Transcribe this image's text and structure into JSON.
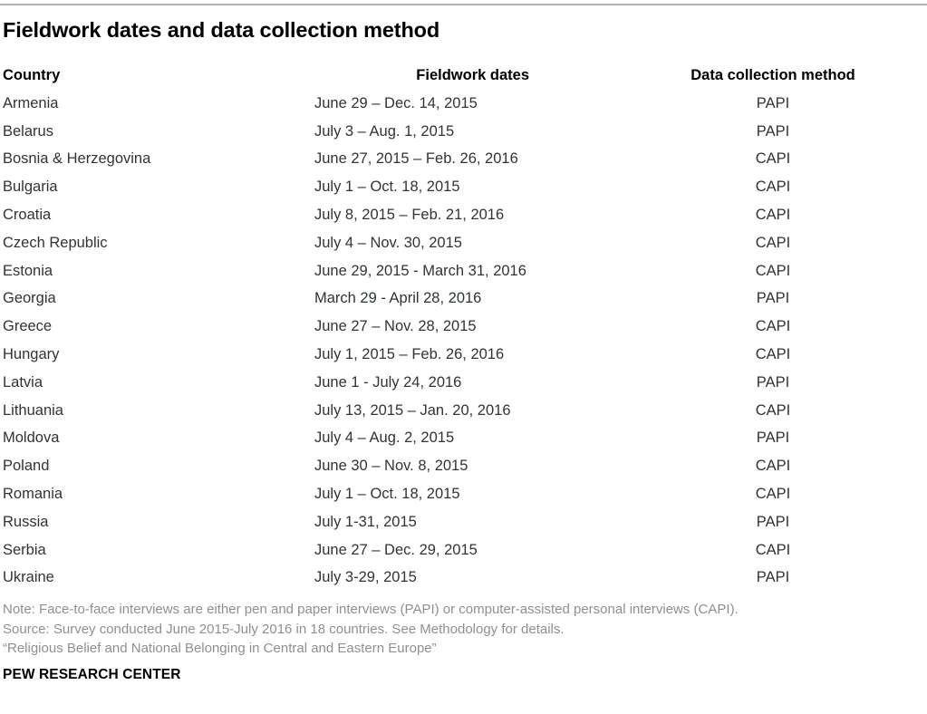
{
  "title": "Fieldwork dates and data collection method",
  "rule_color": "#b2b2b2",
  "table": {
    "headers": {
      "country": "Country",
      "dates": "Fieldwork dates",
      "method": "Data collection method"
    },
    "rows": [
      {
        "country": "Armenia",
        "dates": "June 29 – Dec. 14, 2015",
        "method": "PAPI"
      },
      {
        "country": "Belarus",
        "dates": "July 3 – Aug. 1, 2015",
        "method": "PAPI"
      },
      {
        "country": "Bosnia & Herzegovina",
        "dates": "June 27, 2015 – Feb. 26, 2016",
        "method": "CAPI"
      },
      {
        "country": "Bulgaria",
        "dates": "July 1 – Oct. 18, 2015",
        "method": "CAPI"
      },
      {
        "country": "Croatia",
        "dates": "July 8, 2015 – Feb. 21, 2016",
        "method": "CAPI"
      },
      {
        "country": "Czech Republic",
        "dates": "July 4 – Nov. 30, 2015",
        "method": "CAPI"
      },
      {
        "country": "Estonia",
        "dates": "June 29, 2015 - March 31, 2016",
        "method": "CAPI"
      },
      {
        "country": "Georgia",
        "dates": "March 29 - April 28, 2016",
        "method": "PAPI"
      },
      {
        "country": "Greece",
        "dates": "June 27 – Nov. 28, 2015",
        "method": "CAPI"
      },
      {
        "country": "Hungary",
        "dates": "July 1, 2015 – Feb. 26, 2016",
        "method": "CAPI"
      },
      {
        "country": "Latvia",
        "dates": "June 1 - July 24, 2016",
        "method": "PAPI"
      },
      {
        "country": "Lithuania",
        "dates": "July 13, 2015 – Jan. 20, 2016",
        "method": "CAPI"
      },
      {
        "country": "Moldova",
        "dates": "July 4 – Aug. 2, 2015",
        "method": "PAPI"
      },
      {
        "country": "Poland",
        "dates": "June 30 – Nov. 8, 2015",
        "method": "CAPI"
      },
      {
        "country": "Romania",
        "dates": "July 1 – Oct. 18, 2015",
        "method": "CAPI"
      },
      {
        "country": "Russia",
        "dates": "July 1-31, 2015",
        "method": "PAPI"
      },
      {
        "country": "Serbia",
        "dates": "June 27 – Dec. 29, 2015",
        "method": "CAPI"
      },
      {
        "country": "Ukraine",
        "dates": "July 3-29, 2015",
        "method": "PAPI"
      }
    ]
  },
  "notes": [
    "Note: Face-to-face interviews are either pen and paper interviews (PAPI) or computer-assisted personal interviews (CAPI).",
    "Source: Survey conducted June 2015-July 2016 in 18 countries. See Methodology for details.",
    "“Religious Belief and National Belonging in Central and Eastern Europe”"
  ],
  "brand": "PEW RESEARCH CENTER",
  "chart_data": {
    "type": "table",
    "title": "Fieldwork dates and data collection method",
    "columns": [
      "Country",
      "Fieldwork dates",
      "Data collection method"
    ],
    "rows": [
      [
        "Armenia",
        "June 29 – Dec. 14, 2015",
        "PAPI"
      ],
      [
        "Belarus",
        "July 3 – Aug. 1, 2015",
        "PAPI"
      ],
      [
        "Bosnia & Herzegovina",
        "June 27, 2015 – Feb. 26, 2016",
        "CAPI"
      ],
      [
        "Bulgaria",
        "July 1 – Oct. 18, 2015",
        "CAPI"
      ],
      [
        "Croatia",
        "July 8, 2015 – Feb. 21, 2016",
        "CAPI"
      ],
      [
        "Czech Republic",
        "July 4 – Nov. 30, 2015",
        "CAPI"
      ],
      [
        "Estonia",
        "June 29, 2015 - March 31, 2016",
        "CAPI"
      ],
      [
        "Georgia",
        "March 29 - April 28, 2016",
        "PAPI"
      ],
      [
        "Greece",
        "June 27 – Nov. 28, 2015",
        "CAPI"
      ],
      [
        "Hungary",
        "July 1, 2015 – Feb. 26, 2016",
        "CAPI"
      ],
      [
        "Latvia",
        "June 1 - July 24, 2016",
        "PAPI"
      ],
      [
        "Lithuania",
        "July 13, 2015 – Jan. 20, 2016",
        "CAPI"
      ],
      [
        "Moldova",
        "July 4 – Aug. 2, 2015",
        "PAPI"
      ],
      [
        "Poland",
        "June 30 – Nov. 8, 2015",
        "CAPI"
      ],
      [
        "Romania",
        "July 1 – Oct. 18, 2015",
        "CAPI"
      ],
      [
        "Russia",
        "July 1-31, 2015",
        "PAPI"
      ],
      [
        "Serbia",
        "June 27 – Dec. 29, 2015",
        "CAPI"
      ],
      [
        "Ukraine",
        "July 3-29, 2015",
        "PAPI"
      ]
    ],
    "n_rows": 18,
    "method_counts": {
      "PAPI": 7,
      "CAPI": 11
    }
  }
}
